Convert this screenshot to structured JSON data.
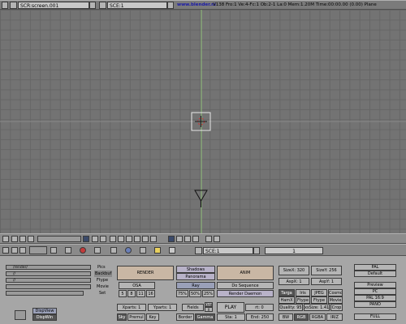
{
  "topbar": {
    "screen_name": "SCR:screen.001",
    "scene_name": "SCE:1",
    "info_url": "www.blender.nl",
    "info_stats": "V138  Fro:1  Ve:4-Fc:1  Ob:2-1 La:0  Mem:1.20M  Time:00:00.00 (0.00)  Plane"
  },
  "viewport": {
    "grid_color": "#666666",
    "axis_color": "#8fbf7a",
    "object_name": "Plane",
    "camera_icon": "camera-icon",
    "cursor_icon": "3d-cursor-icon"
  },
  "view_header": {
    "icons": [
      "window-type-icon",
      "full-screen-icon",
      "home-icon",
      "view-menu-icon",
      "layer-1-icon",
      "layer-2-icon",
      "layer-3-icon",
      "layer-4-icon",
      "layer-5-icon",
      "layer-6-icon",
      "local-view-icon",
      "view-mode-icon",
      "draw-type-icon",
      "zoom-icon",
      "pan-icon",
      "rotate-icon",
      "grab-icon"
    ]
  },
  "buttons_header": {
    "tabs": [
      "view-icon",
      "lamp-icon",
      "material-icon",
      "texture-icon",
      "world-icon",
      "anim-icon",
      "edit-icon",
      "scene-icon",
      "sound-icon"
    ],
    "scene_label": "SCE:1",
    "frame": "1"
  },
  "render_panel": {
    "paths": [
      "/render/",
      "//",
      "//",
      "",
      ""
    ],
    "path_labels": [
      "Pics",
      "Backbuf",
      "Ftype",
      "Movie",
      "Set"
    ],
    "dispview": "DispView",
    "dispwin": "DispWin",
    "render": "RENDER",
    "osa": "OSA",
    "osa_values": [
      "5",
      "8",
      "11",
      "16"
    ],
    "xparts": "Xparts: 1",
    "yparts": "Yparts: 1",
    "shadows": "Shadows",
    "panorama": "Panorama",
    "ray": "Ray",
    "percent": [
      "75%",
      "50%",
      "25%"
    ],
    "fields": "Fields",
    "odd": "Odd",
    "x": "X",
    "sky": "Sky",
    "premul": "Premul",
    "key": "Key",
    "border": "Border",
    "gamma": "Gamma",
    "anim": "ANIM",
    "do_sequence": "Do Sequence",
    "render_daemon": "Render Daemon",
    "play": "PLAY",
    "rt": "rt: 0",
    "sta": "Sta: 1",
    "end": "End: 250",
    "sizex": "SizeX: 320",
    "sizey": "SizeY: 256",
    "aspx": "AspX: 1",
    "aspy": "AspY: 1",
    "formats1": [
      "Targa",
      "Iris",
      "JPEG",
      "Cosmo"
    ],
    "formats2": [
      "HamX",
      "Ftype",
      "Ftype",
      "Movie"
    ],
    "quality": "Quality: 95",
    "xsize": "xsSize: 1.41",
    "crop": "Crop",
    "bw": "BW",
    "rgb": "RGB",
    "rgba": "RGBA",
    "irix": "IRIZ",
    "presets": [
      "PAL",
      "Default",
      "Preview",
      "PC",
      "PAL 16:9",
      "PANO",
      "FULL"
    ]
  }
}
